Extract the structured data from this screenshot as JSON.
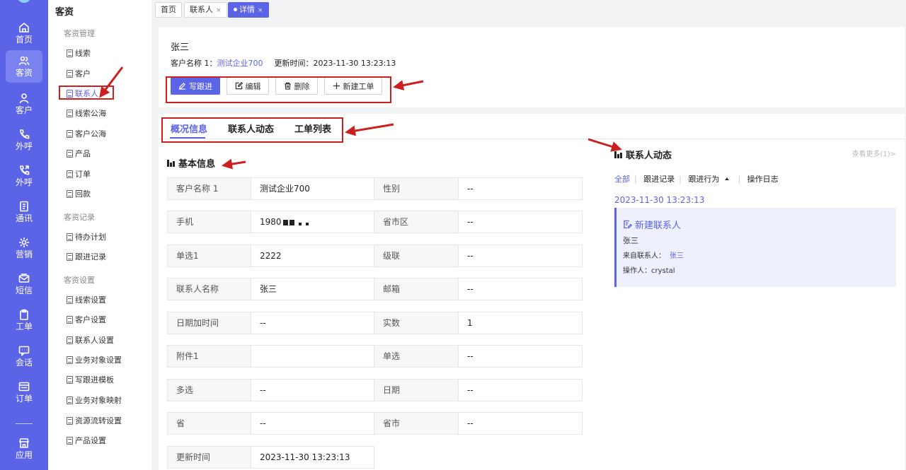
{
  "rail": {
    "items": [
      {
        "label": "首页",
        "icon": "home-icon"
      },
      {
        "label": "客资",
        "icon": "users-icon",
        "active": true
      },
      {
        "label": "客户",
        "icon": "user-icon"
      },
      {
        "label": "外呼",
        "icon": "phone-icon"
      },
      {
        "label": "外呼",
        "icon": "phone-out-icon"
      },
      {
        "label": "通讯",
        "icon": "contacts-book-icon"
      },
      {
        "label": "营销",
        "icon": "gear-flower-icon"
      },
      {
        "label": "短信",
        "icon": "mail-icon"
      },
      {
        "label": "工单",
        "icon": "clipboard-icon"
      },
      {
        "label": "会话",
        "icon": "chat-icon"
      },
      {
        "label": "订单",
        "icon": "order-icon"
      },
      {
        "label": "应用",
        "icon": "store-icon"
      }
    ]
  },
  "menu": {
    "title": "客资",
    "sections": [
      {
        "title": "客资管理",
        "items": [
          "线索",
          "客户",
          "联系人",
          "线索公海",
          "客户公海",
          "产品",
          "订单",
          "回款"
        ]
      },
      {
        "title": "客资记录",
        "items": [
          "待办计划",
          "跟进记录"
        ]
      },
      {
        "title": "客资设置",
        "items": [
          "线索设置",
          "客户设置",
          "联系人设置",
          "业务对象设置",
          "写跟进模板",
          "业务对象映射",
          "资源流转设置",
          "产品设置"
        ]
      }
    ],
    "active_item": "联系人"
  },
  "tabs": [
    {
      "label": "首页",
      "closable": false
    },
    {
      "label": "联系人",
      "closable": true
    },
    {
      "label": "详情",
      "closable": true,
      "active": true
    }
  ],
  "tab_close_glyph": "×",
  "header": {
    "name": "张三",
    "customer_label": "客户名称 1：",
    "customer_value": "测试企业700",
    "updated_label": "更新时间：",
    "updated_value": "2023-11-30 13:23:13",
    "buttons": {
      "follow": "写跟进",
      "edit": "编辑",
      "delete": "删除",
      "new_ticket": "新建工单"
    }
  },
  "detail_tabs": [
    "概况信息",
    "联系人动态",
    "工单列表"
  ],
  "basic_info": {
    "title": "基本信息",
    "rows": [
      {
        "l1": "客户名称 1",
        "v1": "测试企业700",
        "l2": "性别",
        "v2": "--"
      },
      {
        "l1": "手机",
        "v1": "1980",
        "l2": "省市区",
        "v2": "--"
      },
      {
        "l1": "单选1",
        "v1": "2222",
        "l2": "级联",
        "v2": "--"
      },
      {
        "l1": "联系人名称",
        "v1": "张三",
        "l2": "邮箱",
        "v2": "--"
      },
      {
        "l1": "日期加时间",
        "v1": "--",
        "l2": "实数",
        "v2": "1"
      },
      {
        "l1": "附件1",
        "v1": "",
        "l2": "单选",
        "v2": "--"
      },
      {
        "l1": "多选",
        "v1": "--",
        "l2": "日期",
        "v2": "--"
      },
      {
        "l1": "省",
        "v1": "--",
        "l2": "省市",
        "v2": "--"
      },
      {
        "l1": "更新时间",
        "v1": "2023-11-30 13:23:13"
      }
    ]
  },
  "activity": {
    "title": "联系人动态",
    "more": "查看更多(1)>",
    "filters": [
      "全部",
      "跟进记录",
      "跟进行为",
      "操作日志"
    ],
    "time": "2023-11-30 13:23:13",
    "card": {
      "title": "新建联系人",
      "name": "张三",
      "from_label": "来自联系人：",
      "from_value": "张三",
      "operator_label": "操作人：",
      "operator_value": "crystal"
    }
  },
  "colors": {
    "accent": "#5b63e6",
    "annotation": "#cc1f1f"
  }
}
